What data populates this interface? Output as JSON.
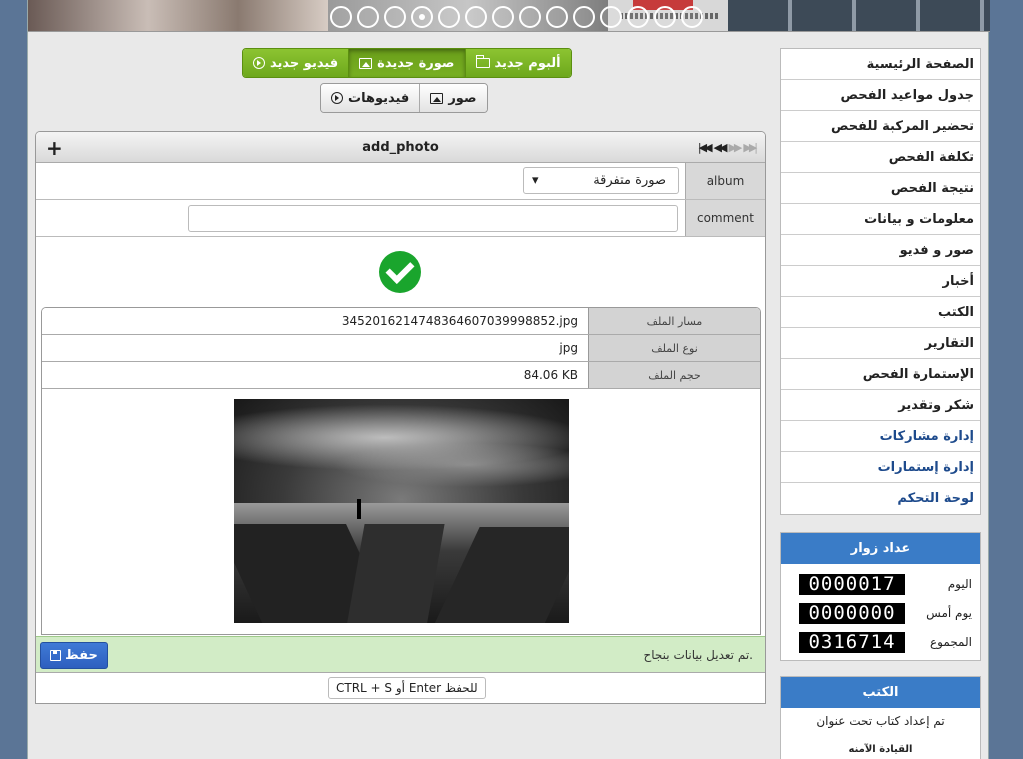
{
  "banner": {
    "slide_count": 14,
    "active_slide": 4
  },
  "toolbar": {
    "new_album": "ألبوم جديد",
    "new_photo": "صورة جديدة",
    "new_video": "فيديو جديد",
    "photos": "صور",
    "videos": "فيديوهات"
  },
  "form": {
    "title": "add_photo",
    "album_label": "album",
    "album_value": "صورة متفرقة",
    "comment_label": "comment",
    "comment_value": ""
  },
  "file_info": {
    "path_label": "مسار الملف",
    "path_value": "3452016214748364607039998852.jpg",
    "type_label": "نوع الملف",
    "type_value": "jpg",
    "size_label": "حجم الملف",
    "size_value": "84.06 KB"
  },
  "status": {
    "message": "تم تعديل بيانات بنجاح.",
    "save_label": "حفظ",
    "shortcut_hint": "CTRL + S أو Enter للحفظ"
  },
  "sidebar": {
    "items": [
      {
        "label": "الصفحة الرئيسية"
      },
      {
        "label": "جدول مواعيد الفحص"
      },
      {
        "label": "تحضير المركبة للفحص"
      },
      {
        "label": "تكلفة الفحص"
      },
      {
        "label": "نتيجة الفحص"
      },
      {
        "label": "معلومات و بيانات"
      },
      {
        "label": "صور و فديو"
      },
      {
        "label": "أخبار"
      },
      {
        "label": "الكتب"
      },
      {
        "label": "التقارير"
      },
      {
        "label": "الإستمارة الفحص"
      },
      {
        "label": "شكر وتقدير"
      },
      {
        "label": "إدارة مشاركات"
      },
      {
        "label": "إدارة إستمارات"
      },
      {
        "label": "لوحة التحكم"
      }
    ]
  },
  "counter": {
    "title": "عداد زوار",
    "today_label": "اليوم",
    "today_value": "0000017",
    "yesterday_label": "يوم أمس",
    "yesterday_value": "0000000",
    "total_label": "المجموع",
    "total_value": "0316714"
  },
  "books": {
    "title": "الكتب",
    "line1": "تم إعداد كتاب تحت عنوان",
    "line2": "القيادة الآمنه"
  },
  "colors": {
    "green_button": "#7ab524",
    "blue_header": "#3a7cc7",
    "success_bg": "#d2ecc6",
    "save_button": "#3a6fcf"
  }
}
